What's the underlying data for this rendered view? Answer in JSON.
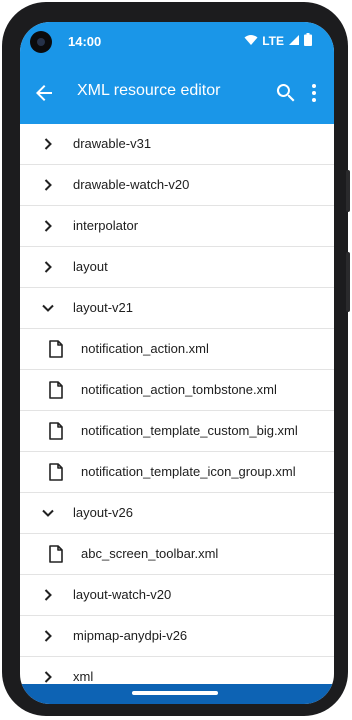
{
  "status": {
    "time": "14:00",
    "network": "LTE"
  },
  "appbar": {
    "title": "XML resource editor"
  },
  "colors": {
    "accent": "#1a96e8",
    "navbar": "#0d63b4"
  },
  "list": {
    "rows": [
      {
        "label": "drawable-v31",
        "type": "folder",
        "expanded": false
      },
      {
        "label": "drawable-watch-v20",
        "type": "folder",
        "expanded": false
      },
      {
        "label": "interpolator",
        "type": "folder",
        "expanded": false
      },
      {
        "label": "layout",
        "type": "folder",
        "expanded": false
      },
      {
        "label": "layout-v21",
        "type": "folder",
        "expanded": true
      },
      {
        "label": "notification_action.xml",
        "type": "file"
      },
      {
        "label": "notification_action_tombstone.xml",
        "type": "file"
      },
      {
        "label": "notification_template_custom_big.xml",
        "type": "file"
      },
      {
        "label": "notification_template_icon_group.xml",
        "type": "file"
      },
      {
        "label": "layout-v26",
        "type": "folder",
        "expanded": true
      },
      {
        "label": "abc_screen_toolbar.xml",
        "type": "file"
      },
      {
        "label": "layout-watch-v20",
        "type": "folder",
        "expanded": false
      },
      {
        "label": "mipmap-anydpi-v26",
        "type": "folder",
        "expanded": false
      },
      {
        "label": "xml",
        "type": "folder",
        "expanded": false
      }
    ]
  }
}
